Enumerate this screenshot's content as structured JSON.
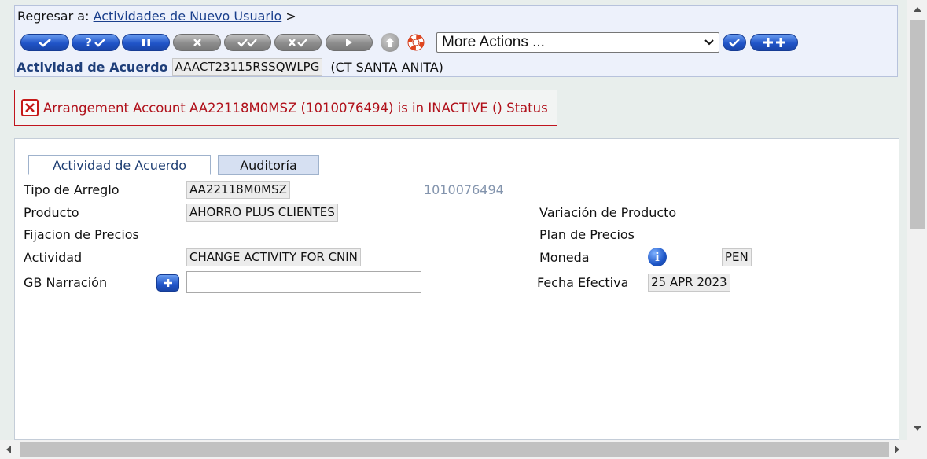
{
  "breadcrumb": {
    "prefix": "Regresar a:",
    "link": "Actividades de Nuevo Usuario",
    "suffix": ">"
  },
  "toolbar": {
    "buttons": [
      {
        "name": "validate-icon",
        "style": "blue"
      },
      {
        "name": "validate-query-icon",
        "style": "blue",
        "label": "?"
      },
      {
        "name": "hold-icon",
        "style": "blue"
      },
      {
        "name": "delete-icon",
        "style": "grey"
      },
      {
        "name": "authorise-icon",
        "style": "grey"
      },
      {
        "name": "reverse-icon",
        "style": "grey"
      },
      {
        "name": "next-icon",
        "style": "grey"
      },
      {
        "name": "upload-icon",
        "style": "grey"
      },
      {
        "name": "help-lifebuoy-icon",
        "style": "red"
      }
    ],
    "more_actions": "More Actions ...",
    "after_buttons": [
      {
        "name": "go-icon",
        "style": "blue"
      },
      {
        "name": "add-new-icon",
        "style": "blue"
      }
    ]
  },
  "activity": {
    "label": "Actividad de Acuerdo",
    "id": "AAACT23115RSSQWLPG",
    "desc": "(CT SANTA ANITA)"
  },
  "error": {
    "message": "Arrangement Account AA22118M0MSZ (1010076494) is in INACTIVE () Status"
  },
  "tabs": [
    {
      "label": "Actividad de Acuerdo",
      "active": true
    },
    {
      "label": "Auditoría",
      "active": false
    }
  ],
  "form": {
    "tipo_arreglo": {
      "label": "Tipo de Arreglo",
      "value": "AA22118M0MSZ",
      "extra": "1010076494"
    },
    "producto": {
      "label": "Producto",
      "value": "AHORRO PLUS CLIENTES"
    },
    "fijacion": {
      "label": "Fijacion de Precios"
    },
    "actividad": {
      "label": "Actividad",
      "value": "CHANGE ACTIVITY FOR CNIN"
    },
    "gb_narracion": {
      "label": "GB Narración",
      "value": ""
    },
    "variacion": {
      "label": "Variación de Producto"
    },
    "plan": {
      "label": "Plan de Precios"
    },
    "moneda": {
      "label": "Moneda",
      "value": "PEN"
    },
    "fecha": {
      "label": "Fecha Efectiva",
      "value": "25 APR 2023"
    }
  }
}
